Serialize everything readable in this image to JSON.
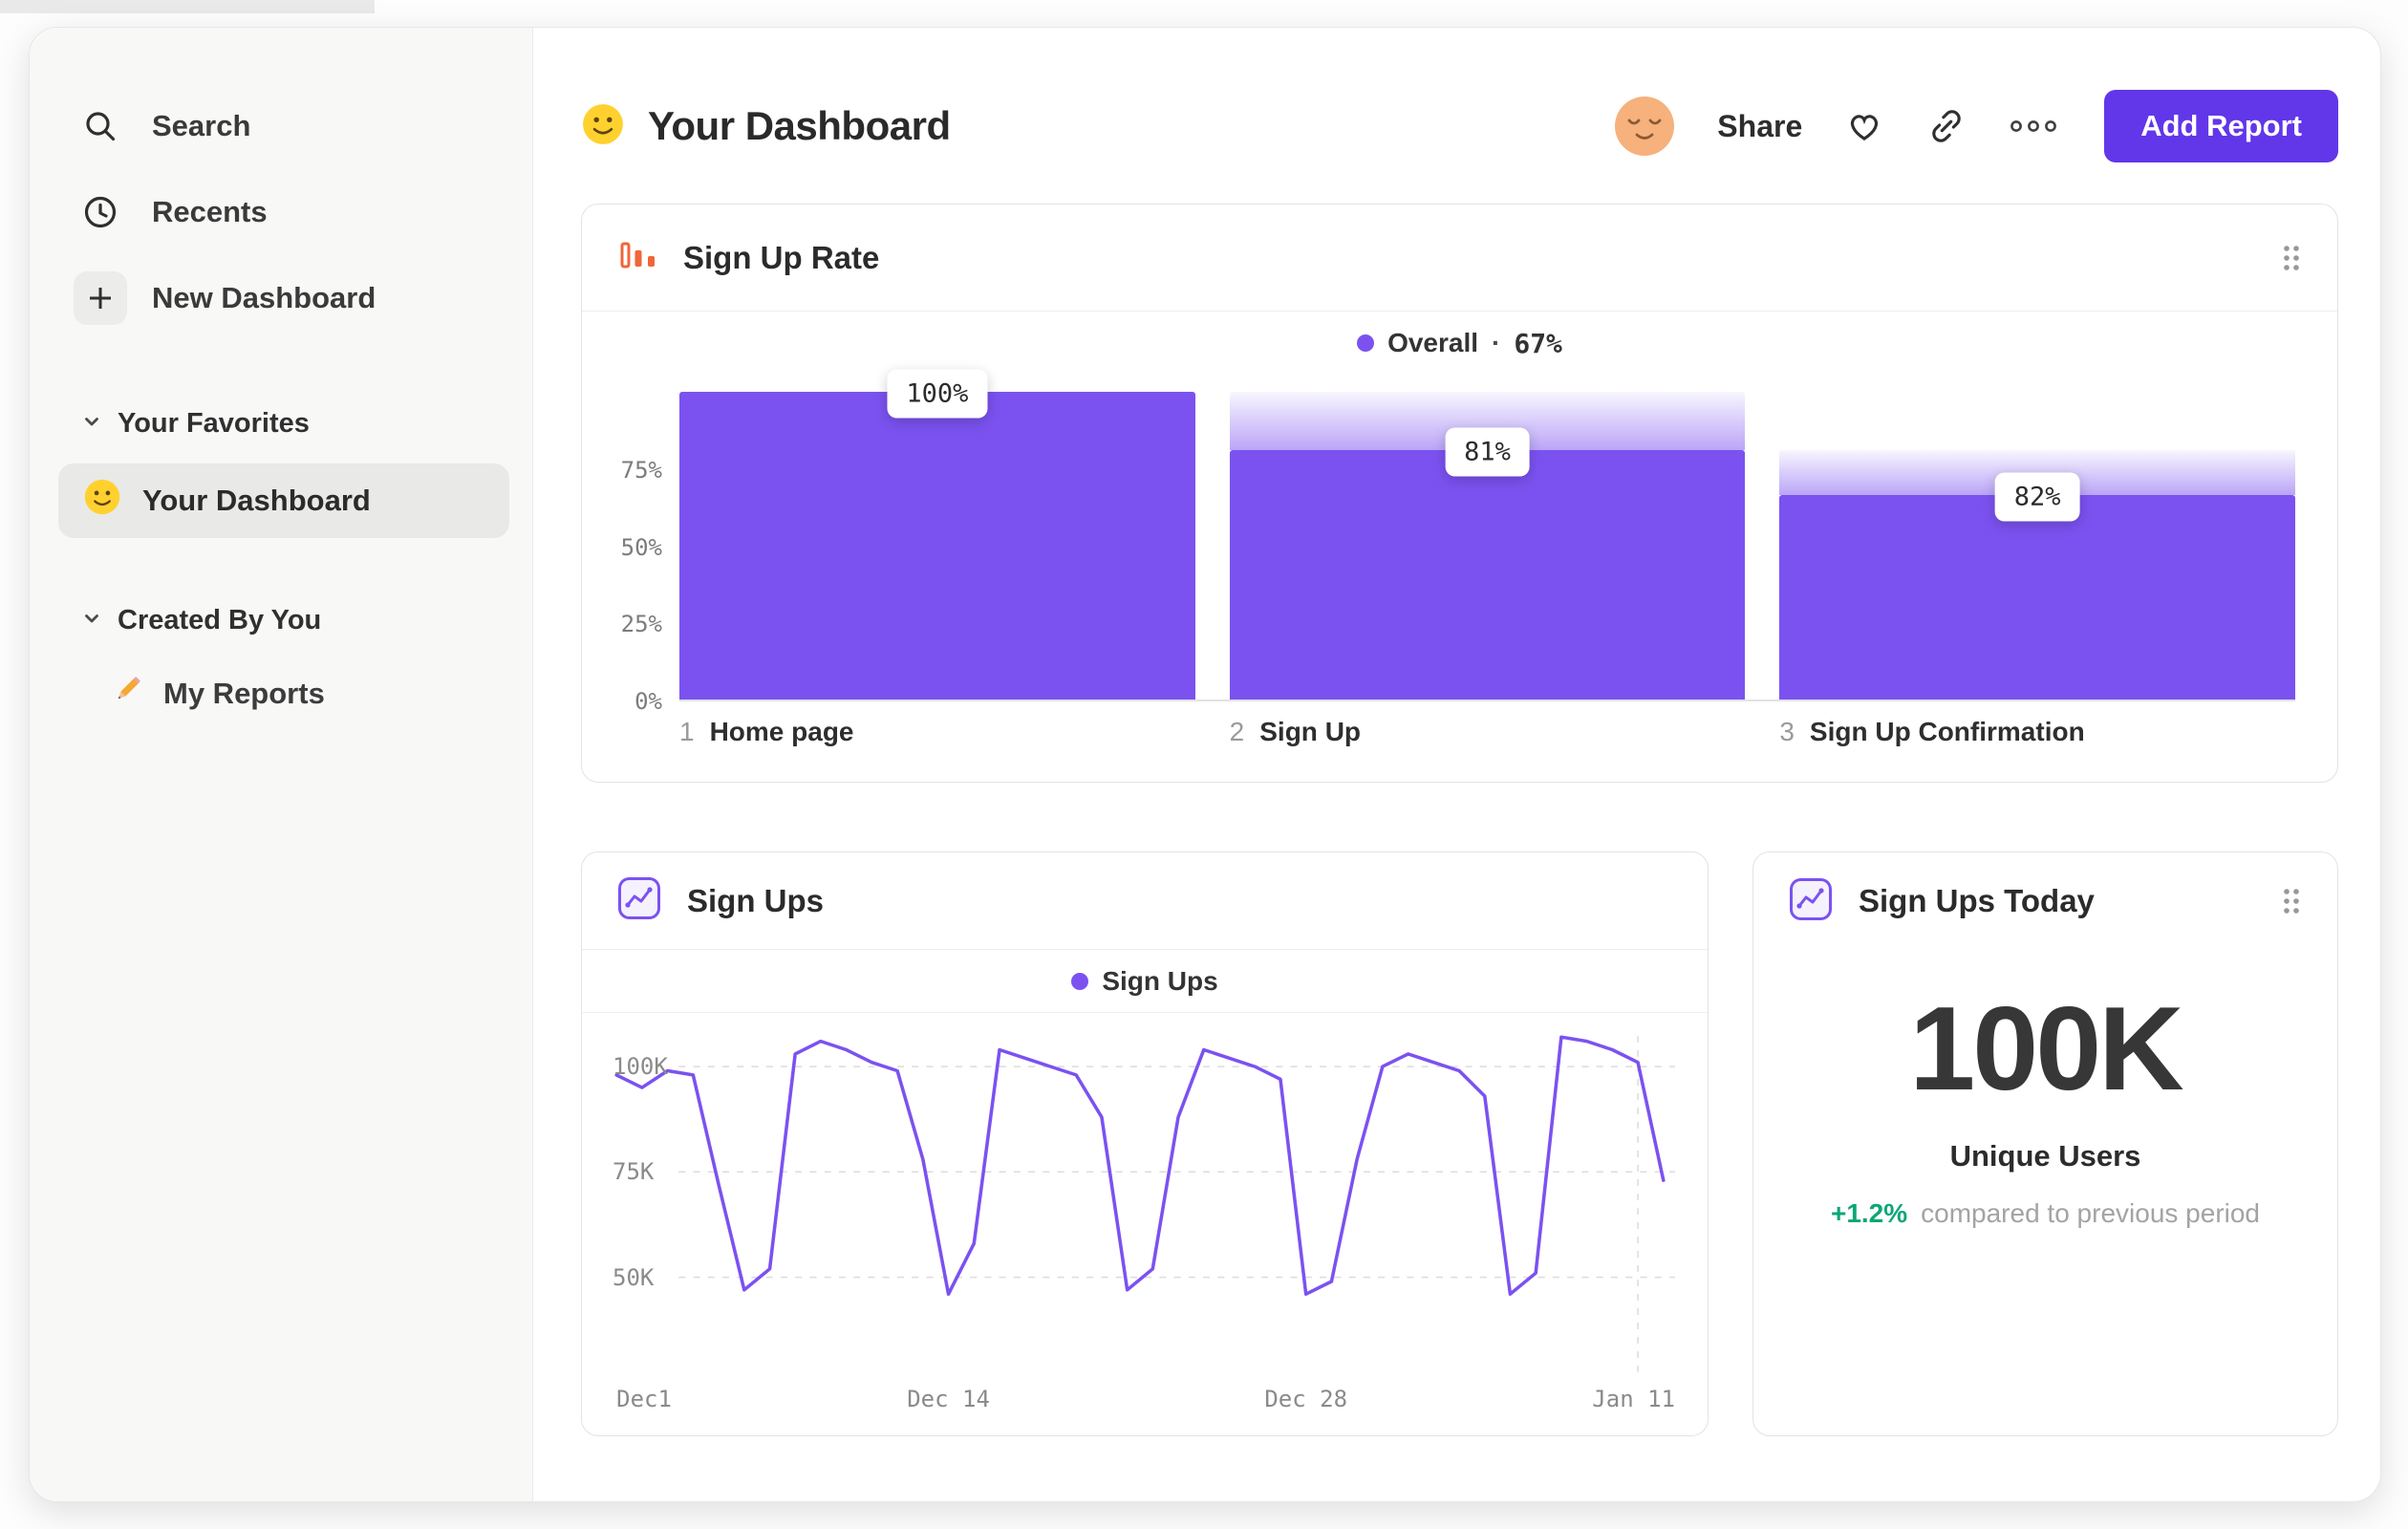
{
  "sidebar": {
    "search_label": "Search",
    "recents_label": "Recents",
    "new_dashboard_label": "New Dashboard",
    "favorites_title": "Your Favorites",
    "favorites_item_label": "Your Dashboard",
    "created_title": "Created By You",
    "created_item_label": "My Reports"
  },
  "header": {
    "title": "Your Dashboard",
    "share_label": "Share",
    "add_report_label": "Add Report"
  },
  "icons": {
    "sidebar_search": "magnifier-icon",
    "sidebar_recents": "clock-icon",
    "sidebar_new_dashboard": "plus-icon",
    "favorites_item": "slightly-smiling-face-emoji",
    "created_item": "pencil-emoji",
    "page_title": "slightly-smiling-face-emoji",
    "avatar": "relieved-face-avatar",
    "actions": [
      "heart-outline-icon",
      "link-icon",
      "ellipsis-icon"
    ],
    "funnel_card": "orange-bar-chart-icon",
    "line_card": "purple-line-chart-icon",
    "kpi_card": "purple-line-chart-icon",
    "drag_handle": "six-dot-drag-handle"
  },
  "colors": {
    "accent_purple": "#7b52f0",
    "button_purple": "#6236e9",
    "positive_green": "#0ca678",
    "icon_orange": "#f0663a",
    "avatar_peach": "#f6b17c",
    "smiley_yellow": "#ffd12f",
    "sidebar_bg": "#f8f8f7",
    "card_border": "#e3e3e3"
  },
  "chart_data": [
    {
      "type": "bar",
      "subtype": "funnel",
      "title": "Sign Up Rate",
      "legend_label": "Overall",
      "legend_sep": "·",
      "legend_value": "67%",
      "overall_conversion_pct": 67,
      "y_ticks_pct": [
        75,
        50,
        25,
        0
      ],
      "ymax_pct": 103,
      "steps": [
        {
          "step": 1,
          "label": "Home page",
          "step_conversion_pct": 100,
          "height_pct": 100,
          "badge": "100%"
        },
        {
          "step": 2,
          "label": "Sign Up",
          "step_conversion_pct": 81,
          "height_pct": 81,
          "badge": "81%"
        },
        {
          "step": 3,
          "label": "Sign Up Confirmation",
          "step_conversion_pct": 82,
          "height_pct": 66.4,
          "badge": "82%"
        }
      ]
    },
    {
      "type": "line",
      "title": "Sign Ups",
      "series": [
        {
          "name": "Sign Ups",
          "unit": "K",
          "values": [
            98,
            95,
            99,
            98,
            72,
            47,
            52,
            103,
            106,
            104,
            101,
            99,
            78,
            46,
            58,
            104,
            102,
            100,
            98,
            88,
            47,
            52,
            88,
            104,
            102,
            100,
            97,
            46,
            49,
            78,
            100,
            103,
            101,
            99,
            93,
            46,
            51,
            107,
            106,
            104,
            101,
            73
          ]
        }
      ],
      "x_ticks": [
        {
          "label": "Dec1",
          "day": 0
        },
        {
          "label": "Dec 14",
          "day": 13
        },
        {
          "label": "Dec 28",
          "day": 27
        },
        {
          "label": "Jan 11",
          "day": 41
        }
      ],
      "y_ticks": [
        {
          "label": "100K",
          "value": 100
        },
        {
          "label": "75K",
          "value": 75
        },
        {
          "label": "50K",
          "value": 50
        }
      ],
      "ylim": [
        27,
        110
      ],
      "today_marker_day": 40,
      "grid": "dashed",
      "legend_position": "top-center"
    },
    {
      "type": "kpi",
      "title": "Sign Ups Today",
      "value": "100K",
      "metric": "Unique Users",
      "delta": "+1.2%",
      "delta_note": "compared to previous period"
    }
  ]
}
